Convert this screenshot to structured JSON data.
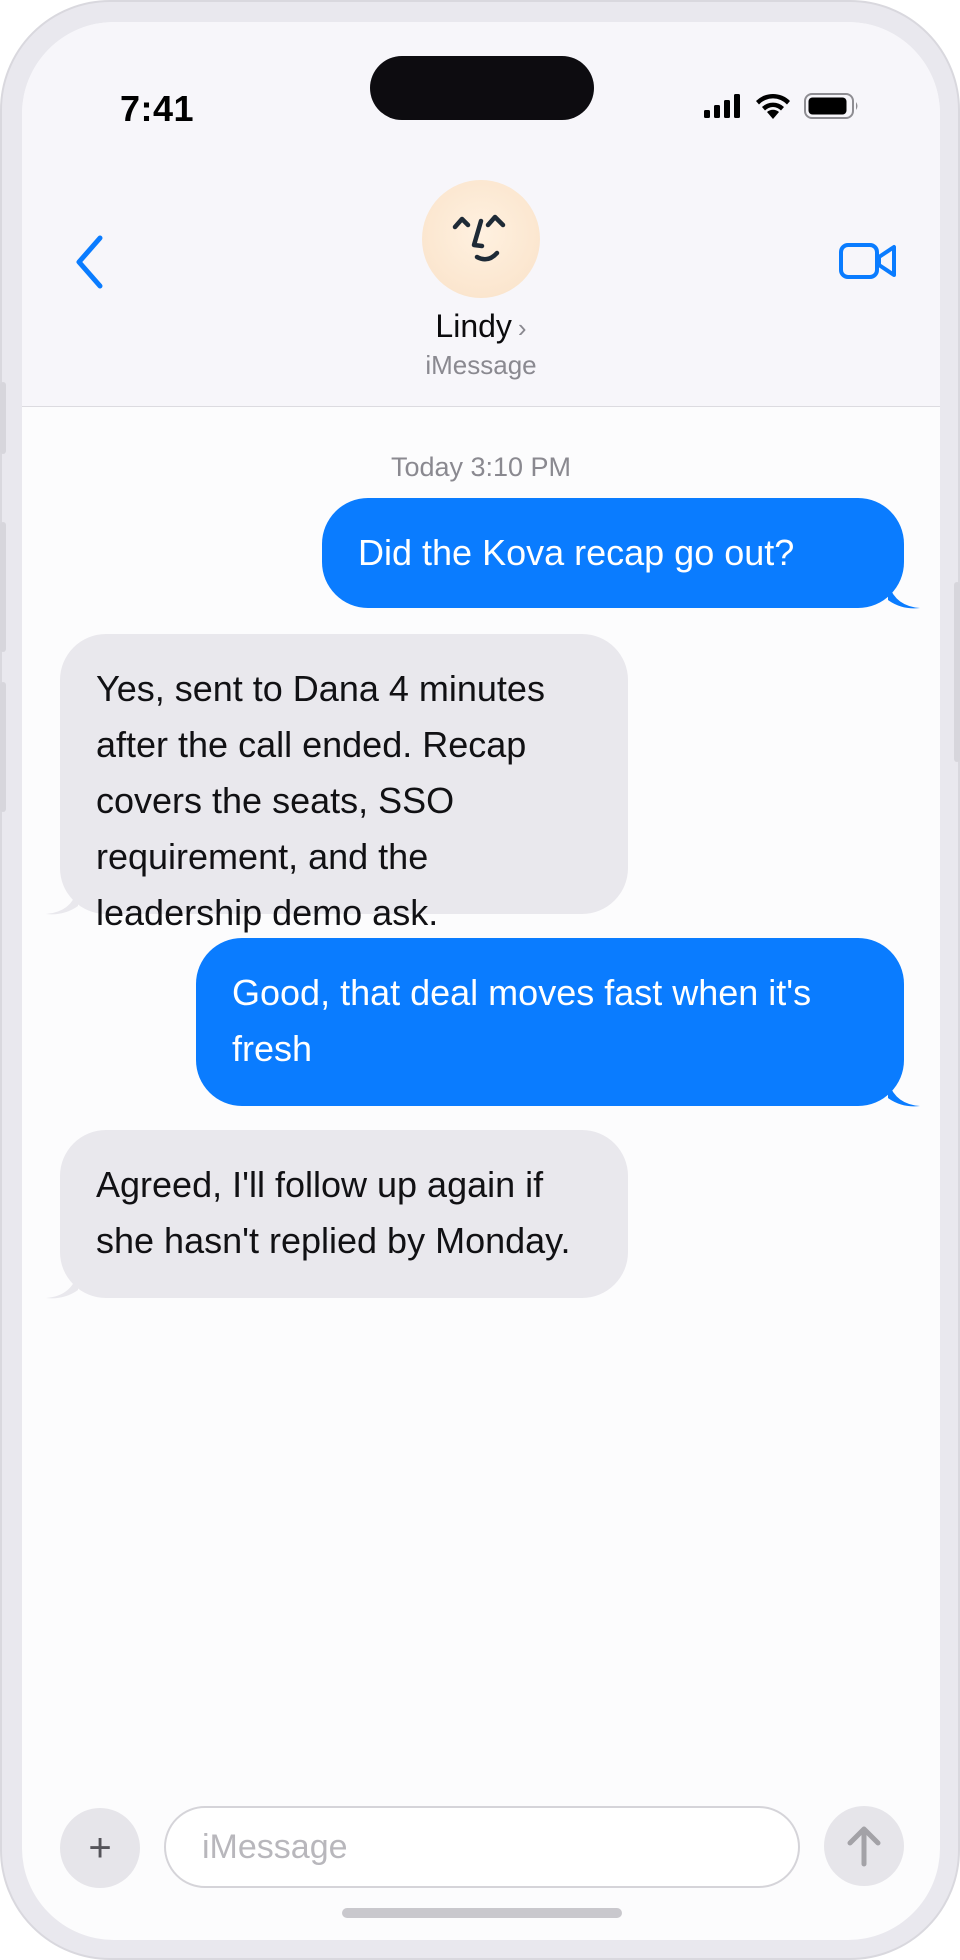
{
  "status_bar": {
    "time": "7:41"
  },
  "header": {
    "contact_name": "Lindy",
    "chevron": "›",
    "service": "iMessage",
    "back_icon": "chevron-left-icon",
    "video_icon": "video-camera-icon"
  },
  "conversation": {
    "timestamp": "Today 3:10 PM",
    "messages": [
      {
        "direction": "outgoing",
        "text": "Did the Kova recap go out?"
      },
      {
        "direction": "incoming",
        "text": "Yes, sent to Dana 4 minutes after the call ended. Recap covers the seats, SSO requirement, and the leadership demo ask."
      },
      {
        "direction": "outgoing",
        "text": "Good, that deal moves fast when it's fresh"
      },
      {
        "direction": "incoming",
        "text": "Agreed, I'll follow up again if she hasn't replied by Monday."
      }
    ]
  },
  "composer": {
    "plus_label": "+",
    "placeholder": "iMessage",
    "value": ""
  },
  "colors": {
    "outgoing_bubble": "#0a7cff",
    "incoming_bubble": "#e9e8ed",
    "accent": "#0a7cff"
  }
}
